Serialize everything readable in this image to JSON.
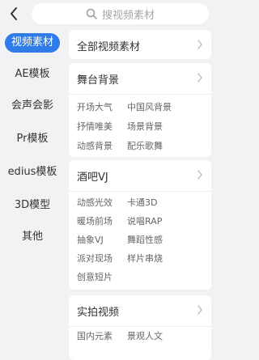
{
  "search": {
    "placeholder": "搜视频素材"
  },
  "sidebar": {
    "items": [
      {
        "label": "视频素材",
        "active": true
      },
      {
        "label": "AE模板"
      },
      {
        "label": "会声会影"
      },
      {
        "label": "Pr模板"
      },
      {
        "label": "edius模板"
      },
      {
        "label": "3D模型"
      },
      {
        "label": "其他"
      }
    ]
  },
  "content": {
    "all_label": "全部视频素材",
    "sections": [
      {
        "title": "舞台背景",
        "tags": [
          "开场大气",
          "中国风背景",
          "抒情唯美",
          "场景背景",
          "动感背景",
          "配乐歌舞"
        ]
      },
      {
        "title": "酒吧VJ",
        "tags": [
          "动感光效",
          "卡通3D",
          "暖场前场",
          "说唱RAP",
          "抽象VJ",
          "舞蹈性感",
          "派对现场",
          "样片串烧",
          "创意短片"
        ]
      },
      {
        "title": "实拍视频",
        "tags": [
          "国内元素",
          "景观人文"
        ]
      }
    ]
  },
  "colors": {
    "accent": "#2f7ce8",
    "background": "#f2f2f5",
    "card": "#ffffff",
    "tag_text": "#666666"
  },
  "icons": {
    "back": "chevron-left-icon",
    "search": "search-icon",
    "chevron": "chevron-right-icon"
  }
}
